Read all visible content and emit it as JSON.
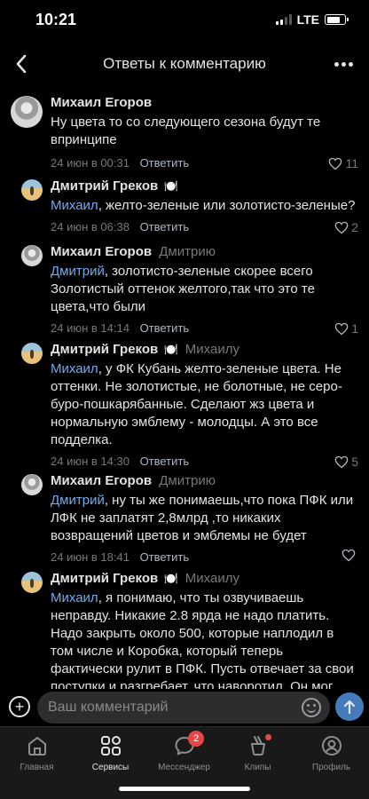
{
  "status": {
    "time": "10:21",
    "network": "LTE"
  },
  "header": {
    "title": "Ответы к комментарию"
  },
  "comments": [
    {
      "author": "Михаил Егоров",
      "reply_to": "",
      "mention": "",
      "text": "Ну цвета то со следующего сезона будут те впринципе",
      "date": "24 июн в 00:31",
      "reply_label": "Ответить",
      "likes": "11"
    },
    {
      "author": "Дмитрий Греков",
      "reply_to": "",
      "mention": "Михаил",
      "text": ", желто-зеленые или золотисто-зеленые?",
      "date": "24 июн в 06:38",
      "reply_label": "Ответить",
      "likes": "2"
    },
    {
      "author": "Михаил Егоров",
      "reply_to": "Дмитрию",
      "mention": "Дмитрий",
      "text": ", золотисто-зеленые скорее всего Золотистый оттенок желтого,так что это те цвета,что были",
      "date": "24 июн в 14:14",
      "reply_label": "Ответить",
      "likes": "1"
    },
    {
      "author": "Дмитрий Греков",
      "reply_to": "Михаилу",
      "mention": "Михаил",
      "text": ", у ФК Кубань желто-зеленые цвета. Не оттенки. Не золотистые, не болотные, не серо-буро-пошкарябанные. Сделают жз цвета и нормальную эмблему - молодцы. А это все подделка.",
      "date": "24 июн в 14:30",
      "reply_label": "Ответить",
      "likes": "5"
    },
    {
      "author": "Михаил Егоров",
      "reply_to": "Дмитрию",
      "mention": "Дмитрий",
      "text": ", ну ты же понимаешь,что пока ПФК или ЛФК не заплатят 2,8млрд ,то никаких возвращений цветов и эмблемы не будет",
      "date": "24 июн в 18:41",
      "reply_label": "Ответить",
      "likes": ""
    },
    {
      "author": "Дмитрий Греков",
      "reply_to": "Михаилу",
      "mention": "Михаил",
      "text": ", я понимаю, что  ты озвучиваешь неправду. Никакие 2.8 ярда не надо платить. Надо закрыть около 500, которые наплодил в том числе и Коробка, который теперь фактически рулит в ПФК. Пусть отвечает за свои поступки и разгребает, что наворотил. Он мог договориться с игроками, компенсировав им часть долга. Но в итоге пустил",
      "date": "",
      "reply_label": "",
      "likes": ""
    }
  ],
  "input": {
    "placeholder": "Ваш комментарий"
  },
  "tabs": [
    {
      "label": "Главная",
      "icon": "home-icon"
    },
    {
      "label": "Сервисы",
      "icon": "services-icon"
    },
    {
      "label": "Мессенджер",
      "icon": "messenger-icon",
      "badge": "2"
    },
    {
      "label": "Клипы",
      "icon": "clips-icon"
    },
    {
      "label": "Профиль",
      "icon": "profile-icon"
    }
  ],
  "colors": {
    "background": "#000000",
    "accent_link": "#71aaeb",
    "send_button": "#447bba",
    "badge": "#e64646"
  }
}
